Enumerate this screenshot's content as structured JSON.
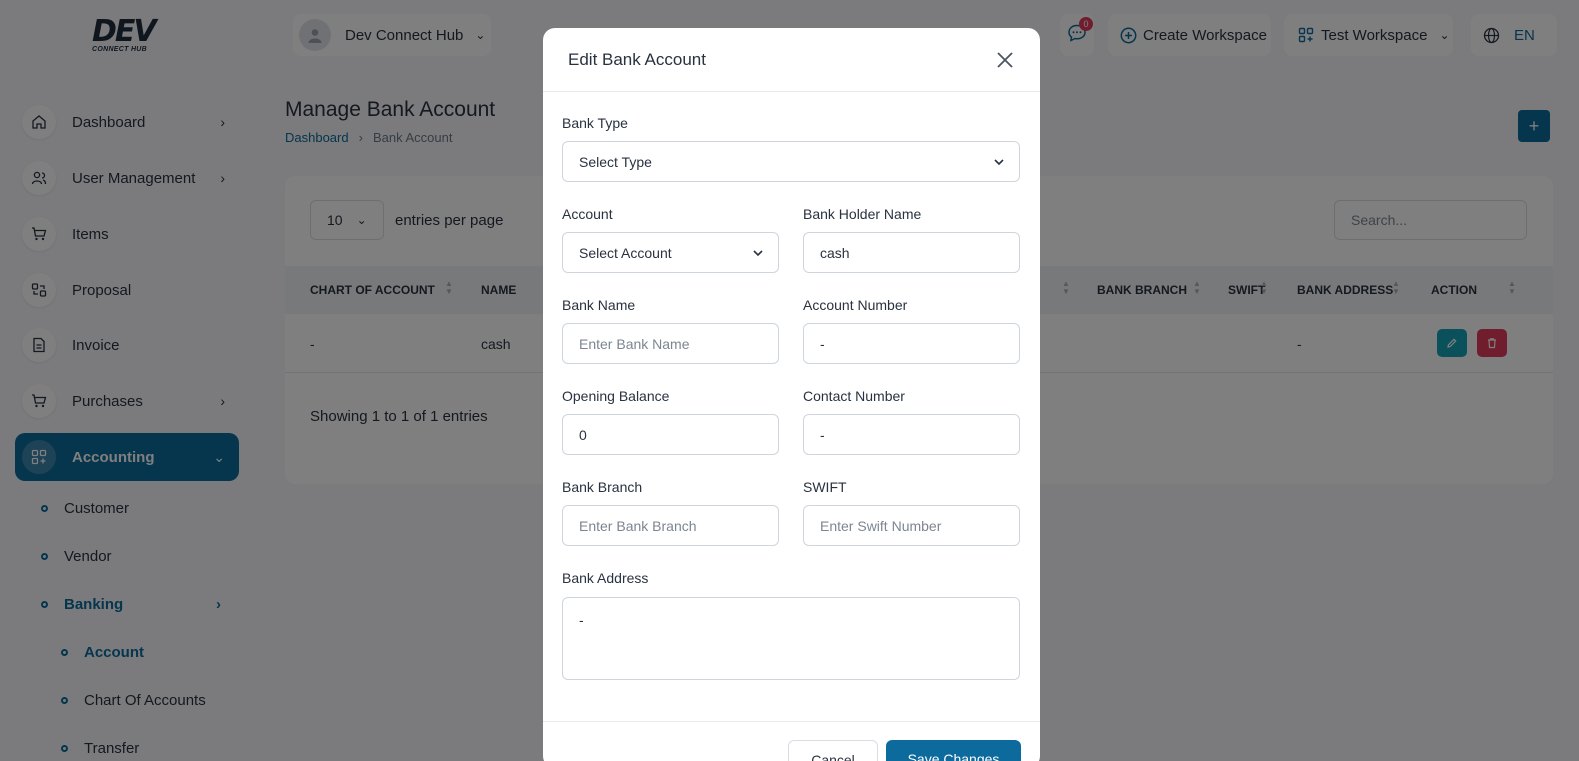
{
  "brand": {
    "logo_big": "DEV",
    "logo_small": "CONNECT HUB"
  },
  "sidebar": {
    "items": [
      {
        "label": "Dashboard",
        "icon": "home-icon"
      },
      {
        "label": "User Management",
        "icon": "users-icon"
      },
      {
        "label": "Items",
        "icon": "cart-icon"
      },
      {
        "label": "Proposal",
        "icon": "proposal-icon"
      },
      {
        "label": "Invoice",
        "icon": "invoice-icon"
      },
      {
        "label": "Purchases",
        "icon": "cart-icon"
      },
      {
        "label": "Accounting",
        "icon": "grid-icon"
      }
    ],
    "sub_items": [
      {
        "label": "Customer"
      },
      {
        "label": "Vendor"
      },
      {
        "label": "Banking"
      },
      {
        "label": "Account"
      },
      {
        "label": "Chart Of Accounts"
      },
      {
        "label": "Transfer"
      }
    ]
  },
  "header": {
    "company": "Dev Connect Hub",
    "notifications_count": "0",
    "create_workspace": "Create Workspace",
    "workspace": "Test Workspace",
    "language": "EN"
  },
  "page": {
    "title": "Manage Bank Account",
    "breadcrumb": {
      "home": "Dashboard",
      "sep": "›",
      "current": "Bank Account"
    },
    "add_button": "+"
  },
  "table": {
    "entries_value": "10",
    "entries_label": "entries per page",
    "search_placeholder": "Search...",
    "headers": [
      "CHART OF ACCOUNT",
      "NAME",
      "ER",
      "BANK BRANCH",
      "SWIFT",
      "BANK ADDRESS",
      "ACTION"
    ],
    "row": {
      "chart_of_account": "-",
      "name": "cash",
      "bank_address": "-"
    },
    "showing": "Showing 1 to 1 of 1 entries"
  },
  "modal": {
    "title": "Edit Bank Account",
    "bank_type": {
      "label": "Bank Type",
      "value": "Select Type"
    },
    "account": {
      "label": "Account",
      "value": "Select Account"
    },
    "bank_holder_name": {
      "label": "Bank Holder Name",
      "value": "cash"
    },
    "bank_name": {
      "label": "Bank Name",
      "placeholder": "Enter Bank Name"
    },
    "account_number": {
      "label": "Account Number",
      "value": "-"
    },
    "opening_balance": {
      "label": "Opening Balance",
      "value": "0"
    },
    "contact_number": {
      "label": "Contact Number",
      "value": "-"
    },
    "bank_branch": {
      "label": "Bank Branch",
      "placeholder": "Enter Bank Branch"
    },
    "swift": {
      "label": "SWIFT",
      "placeholder": "Enter Swift Number"
    },
    "bank_address": {
      "label": "Bank Address",
      "value": "-"
    },
    "cancel_label": "Cancel",
    "save_label": "Save Changes"
  },
  "colors": {
    "primary": "#0c6a9c",
    "edit": "#17a2b8",
    "delete": "#e03a5b",
    "badge": "#e03a5b"
  }
}
